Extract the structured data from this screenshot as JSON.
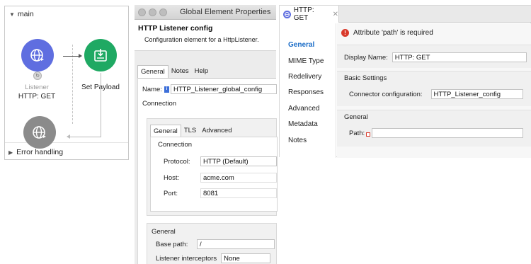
{
  "flow": {
    "name": "main",
    "listener_sublabel": "Listener",
    "listener_label": "HTTP: GET",
    "payload_label": "Set Payload",
    "error_handling": "Error handling"
  },
  "global_element": {
    "window_title": "Global Element Properties",
    "heading": "HTTP Listener config",
    "description": "Configuration element for a HttpListener.",
    "tabs": [
      "General",
      "Notes",
      "Help"
    ],
    "name_label": "Name:",
    "name_value": "HTTP_Listener_global_config",
    "connection_label": "Connection",
    "connection_tabs": [
      "General",
      "TLS",
      "Advanced"
    ],
    "inner_connection_label": "Connection",
    "protocol_label": "Protocol:",
    "protocol_value": "HTTP (Default)",
    "host_label": "Host:",
    "host_value": "acme.com",
    "port_label": "Port:",
    "port_value": "8081",
    "general_label": "General",
    "base_path_label": "Base path:",
    "base_path_value": "/",
    "interceptors_label": "Listener interceptors",
    "interceptors_value": "None"
  },
  "properties": {
    "tab_title": "HTTP: GET",
    "nav": [
      "General",
      "MIME Type",
      "Redelivery",
      "Responses",
      "Advanced",
      "Metadata",
      "Notes"
    ],
    "error_message": "Attribute 'path' is required",
    "display_name_label": "Display Name:",
    "display_name_value": "HTTP: GET",
    "basic_settings_label": "Basic Settings",
    "connector_config_label": "Connector configuration:",
    "connector_config_value": "HTTP_Listener_config",
    "general_label": "General",
    "path_label": "Path:",
    "path_value": ""
  },
  "colors": {
    "listener": "#5f6ee0",
    "set_payload": "#1fa963",
    "error_node": "#8b8b8b",
    "error_icon": "#d93a2b",
    "active_nav": "#1a6cc7"
  }
}
